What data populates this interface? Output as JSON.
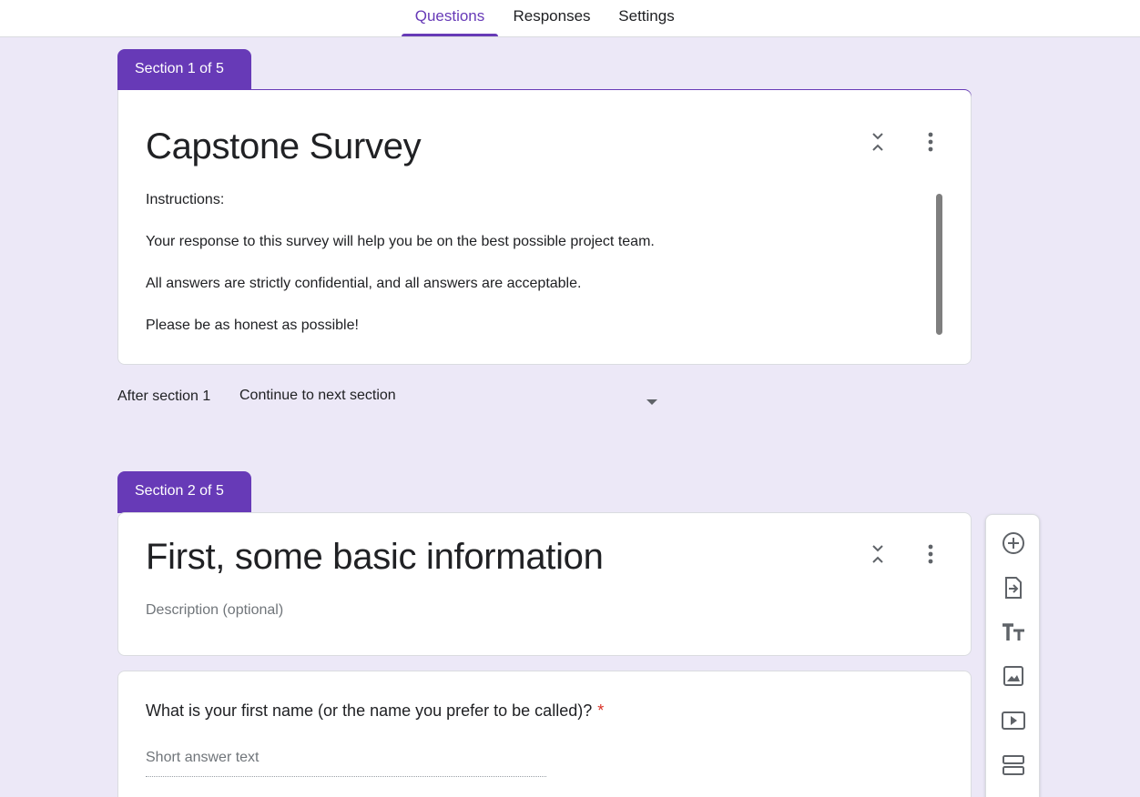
{
  "tabs": [
    {
      "label": "Questions",
      "active": true
    },
    {
      "label": "Responses",
      "active": false
    },
    {
      "label": "Settings",
      "active": false
    }
  ],
  "accent_color": "#673ab7",
  "section1": {
    "badge": "Section 1 of 5",
    "title": "Capstone Survey",
    "description_lines": [
      "Instructions:",
      "Your response to this survey will help you be on the best possible project team.",
      "All answers are strictly confidential, and all answers are acceptable.",
      "Please be as honest as possible!"
    ],
    "after_label": "After section 1",
    "after_value": "Continue to next section"
  },
  "section2": {
    "badge": "Section 2 of 5",
    "title": "First, some basic information",
    "description_placeholder": "Description (optional)"
  },
  "question1": {
    "text": "What is your first name (or the name you prefer to be called)?",
    "required_mark": "*",
    "answer_placeholder": "Short answer text"
  },
  "toolbar_icons": [
    "add-question-icon",
    "import-questions-icon",
    "add-title-icon",
    "add-image-icon",
    "add-video-icon",
    "add-section-icon"
  ]
}
